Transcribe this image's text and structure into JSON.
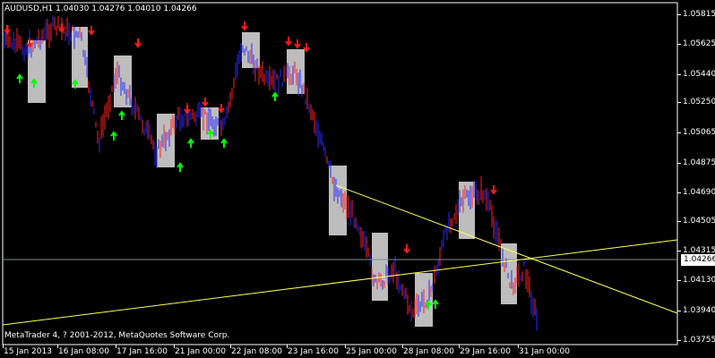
{
  "header": {
    "symbol_line": "AUDUSD,H1  1.04030 1.04276 1.04010 1.04266"
  },
  "footer": {
    "copyright": "MetaTrader 4, ? 2001-2012, MetaQuotes Software Corp."
  },
  "price_axis": {
    "labels": [
      "1.05815",
      "1.05625",
      "1.05440",
      "1.05250",
      "1.05065",
      "1.04875",
      "1.04690",
      "1.04505",
      "1.04315",
      "1.04130",
      "1.03940",
      "1.03755"
    ],
    "current_price": "1.04266"
  },
  "time_axis": {
    "labels": [
      "15 Jan 2013",
      "16 Jan 08:00",
      "17 Jan 16:00",
      "21 Jan 00:00",
      "22 Jan 08:00",
      "23 Jan 16:00",
      "25 Jan 00:00",
      "28 Jan 08:00",
      "29 Jan 16:00",
      "31 Jan 00:00"
    ]
  },
  "colors": {
    "background": "#000000",
    "bull_bar": "#ff2020",
    "bear_bar": "#2a2aff",
    "highlight_box": "#bdbdbd",
    "down_arrow": "#ff1a1a",
    "up_arrow": "#00ff00",
    "trendline": "#ffff55",
    "current_price_line": "#7f8a99",
    "axis": "#ffffff"
  },
  "chart_data": {
    "type": "line",
    "description": "AUDUSD H1 price bars with fractal arrows and shaded consolidation boxes",
    "x": [
      "15 Jan 2013",
      "16 Jan 08:00",
      "17 Jan 16:00",
      "21 Jan 00:00",
      "22 Jan 08:00",
      "23 Jan 16:00",
      "25 Jan 00:00",
      "28 Jan 08:00",
      "29 Jan 16:00",
      "31 Jan 00:00"
    ],
    "series": [
      {
        "values": [
          1.056,
          1.0565,
          1.053,
          1.0515,
          1.056,
          1.055,
          1.047,
          1.041,
          1.046,
          1.042
        ]
      }
    ],
    "ylim": [
      1.0372,
      1.059
    ],
    "current_price": 1.04266
  }
}
